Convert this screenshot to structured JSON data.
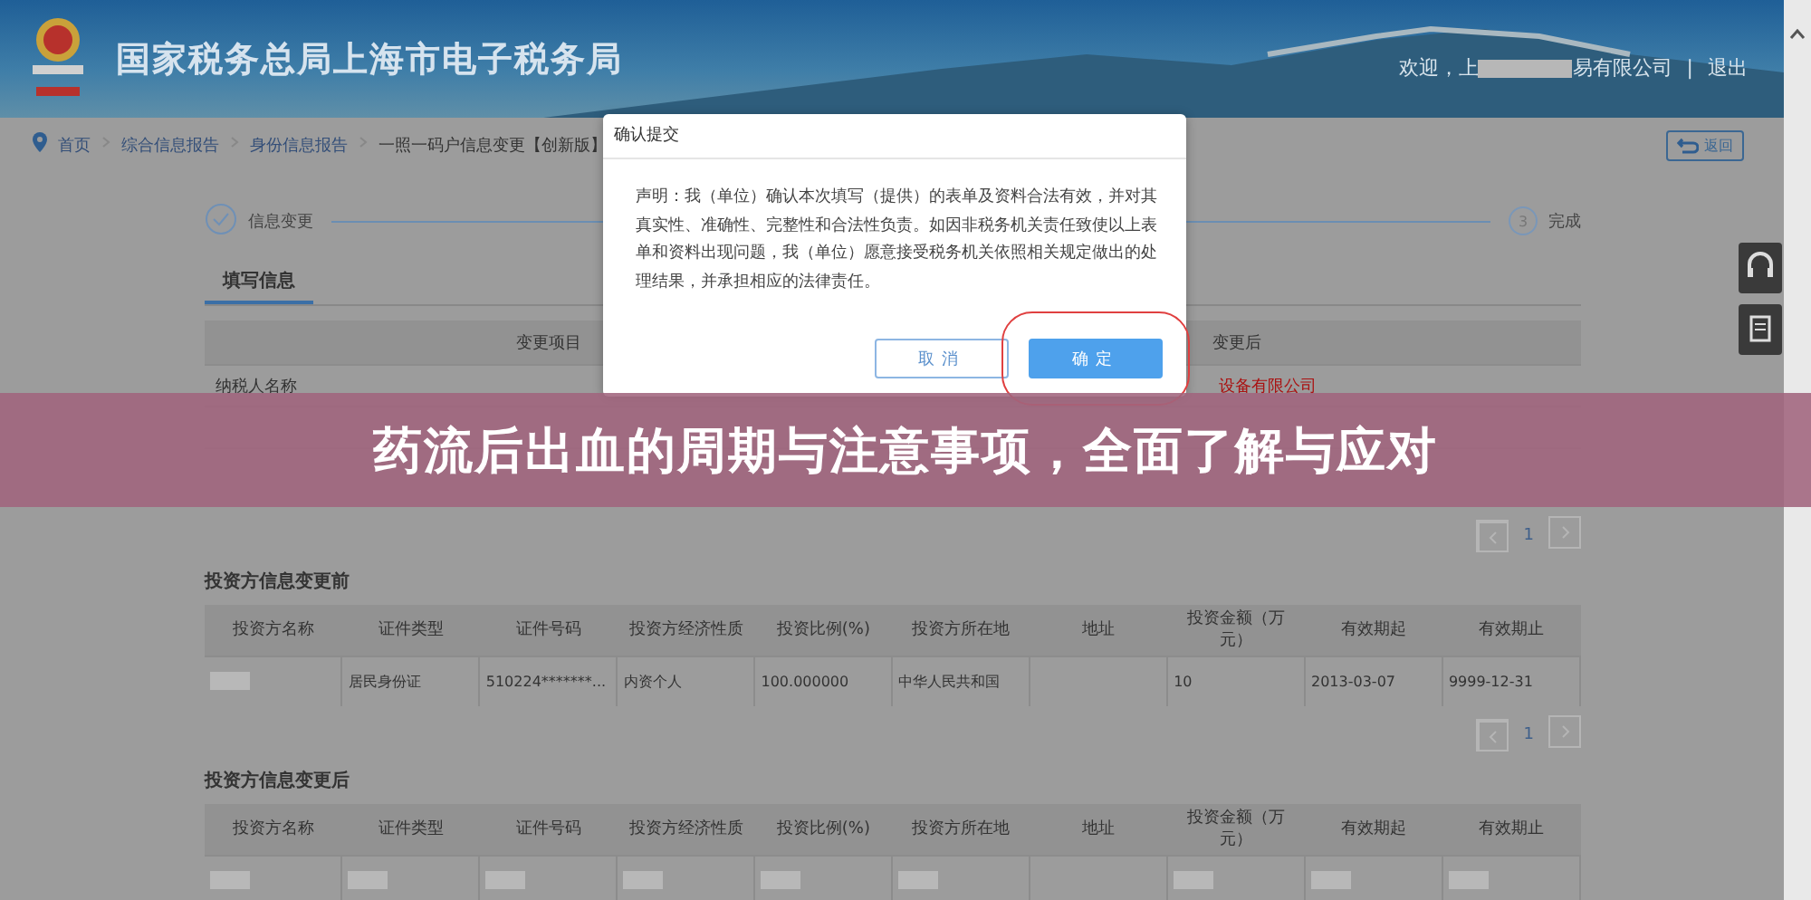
{
  "header": {
    "title": "国家税务总局上海市电子税务局",
    "greeting": "欢迎，上",
    "company": "易有限公司",
    "separator": "|",
    "logout": "退出"
  },
  "breadcrumb": [
    {
      "label": "首页"
    },
    {
      "label": "综合信息报告"
    },
    {
      "label": "身份信息报告"
    },
    {
      "label": "一照一码户信息变更【创新版】"
    }
  ],
  "back_button": "返回",
  "steps": [
    {
      "kind": "done",
      "label": "信息变更"
    },
    {
      "kind": "number",
      "number": "3",
      "label": "完成"
    }
  ],
  "tabs": [
    {
      "label": "填写信息",
      "selected": true
    }
  ],
  "change_table": {
    "columns": [
      "变更项目",
      "变更后"
    ],
    "rows": [
      {
        "item": "纳税人名称",
        "after": "设备有限公司"
      }
    ]
  },
  "investors_before": {
    "page": "1",
    "title": "投资方信息变更前",
    "columns": [
      "投资方名称",
      "证件类型",
      "证件号码",
      "投资方经济性质",
      "投资比例(%)",
      "投资方所在地",
      "地址",
      "投资金额（万元）",
      "有效期起",
      "有效期止"
    ],
    "rows": [
      {
        "cells": [
          {
            "kind": "redacted"
          },
          {
            "kind": "text",
            "text": "居民身份证"
          },
          {
            "kind": "text",
            "text": "510224*******..."
          },
          {
            "kind": "text",
            "text": "内资个人"
          },
          {
            "kind": "text",
            "text": "100.000000"
          },
          {
            "kind": "text",
            "text": "中华人民共和国"
          },
          {
            "kind": "blank"
          },
          {
            "kind": "text",
            "text": "10"
          },
          {
            "kind": "text",
            "text": "2013-03-07"
          },
          {
            "kind": "text",
            "text": "9999-12-31"
          }
        ]
      }
    ]
  },
  "investors_after": {
    "page": "1",
    "title": "投资方信息变更后",
    "columns": [
      "投资方名称",
      "证件类型",
      "证件号码",
      "投资方经济性质",
      "投资比例(%)",
      "投资方所在地",
      "地址",
      "投资金额（万元）",
      "有效期起",
      "有效期止"
    ],
    "rows": [
      {
        "cells": [
          {
            "kind": "redacted"
          },
          {
            "kind": "redacted"
          },
          {
            "kind": "redacted"
          },
          {
            "kind": "redacted"
          },
          {
            "kind": "redacted"
          },
          {
            "kind": "redacted"
          },
          {
            "kind": "blank"
          },
          {
            "kind": "redacted"
          },
          {
            "kind": "redacted"
          },
          {
            "kind": "redacted"
          }
        ]
      }
    ]
  },
  "modal": {
    "title": "确认提交",
    "statement": "声明：我（单位）确认本次填写（提供）的表单及资料合法有效，并对其真实性、准确性、完整性和合法性负责。如因非税务机关责任致使以上表单和资料出现问题，我（单位）愿意接受税务机关依照相关规定做出的处理结果，并承担相应的法律责任。",
    "buttons": [
      {
        "label": "取消",
        "kind": "secondary",
        "highlighted": false
      },
      {
        "label": "确定",
        "kind": "primary",
        "highlighted": true
      }
    ]
  },
  "banner": {
    "text": "药流后出血的周期与注意事项，全面了解与应对"
  }
}
